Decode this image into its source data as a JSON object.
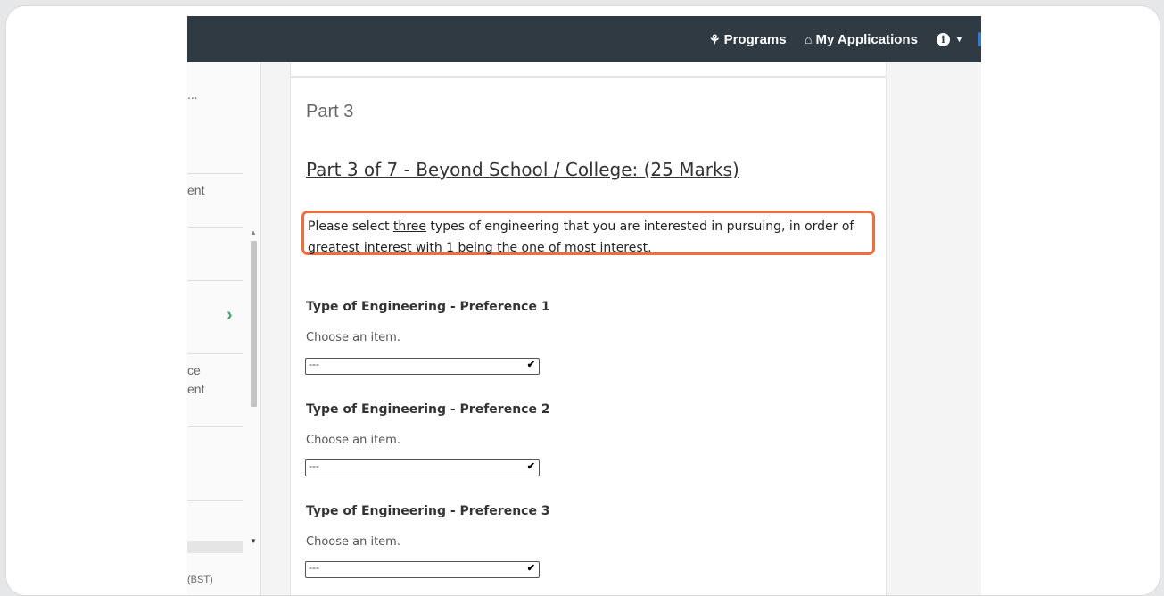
{
  "nav": {
    "programs_label": "Programs",
    "my_applications_label": "My Applications"
  },
  "sidebar": {
    "fragments": [
      "...",
      "ent",
      "ce",
      "ent",
      "(BST)"
    ]
  },
  "main": {
    "part_title": "Part 3",
    "part_heading": "Part 3 of 7 - Beyond School / College: (25 Marks)",
    "instructions": {
      "before": "Please select ",
      "emphasis": "three",
      "after": " types of engineering that you are interested in pursuing, in order of",
      "line2": "greatest interest with 1 being the one of most interest."
    },
    "questions": [
      {
        "label": "Type of Engineering - Preference 1",
        "hint": "Choose an item.",
        "selected": "---"
      },
      {
        "label": "Type of Engineering - Preference 2",
        "hint": "Choose an item.",
        "selected": "---"
      },
      {
        "label": "Type of Engineering - Preference 3",
        "hint": "Choose an item.",
        "selected": "---"
      }
    ]
  },
  "colors": {
    "topbar": "#2f3a42",
    "highlight_border": "#ef6d3f",
    "chevron": "#3aa76d"
  },
  "icons": [
    "programs-icon",
    "home-icon",
    "info-icon",
    "caret-down-icon",
    "chevron-right-icon",
    "scroll-up-icon",
    "scroll-down-icon",
    "select-arrow-icon"
  ]
}
